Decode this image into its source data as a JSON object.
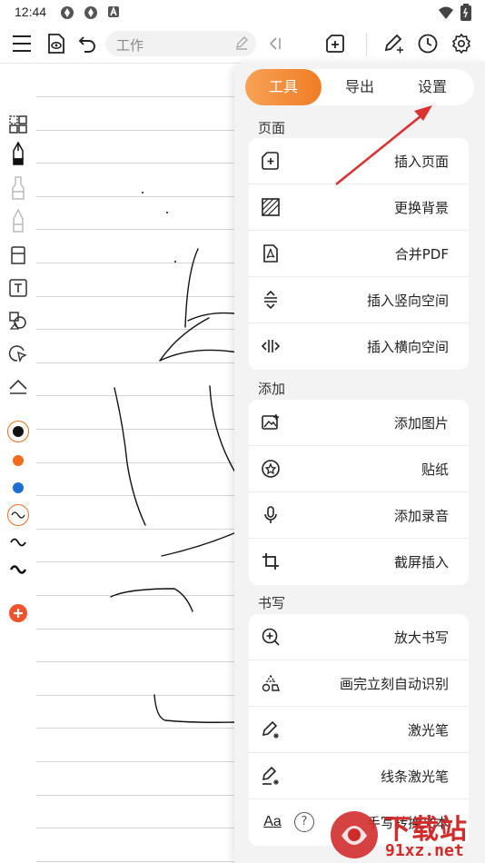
{
  "status_bar": {
    "time": "12:44"
  },
  "toolbar": {
    "title": "工作"
  },
  "panel": {
    "tabs": [
      {
        "label": "工具",
        "active": true
      },
      {
        "label": "导出",
        "active": false
      },
      {
        "label": "设置",
        "active": false
      }
    ],
    "sections": [
      {
        "title": "页面",
        "items": [
          "插入页面",
          "更换背景",
          "合并PDF",
          "插入竖向空间",
          "插入横向空间"
        ]
      },
      {
        "title": "添加",
        "items": [
          "添加图片",
          "贴纸",
          "添加录音",
          "截屏插入"
        ]
      },
      {
        "title": "书写",
        "items": [
          "放大书写",
          "画完立刻自动识别",
          "激光笔",
          "线条激光笔",
          "手写转换文本"
        ]
      }
    ],
    "help_glyph": "?",
    "font_icon_label": "Aa"
  },
  "colors": {
    "accent": "#f07c26",
    "pen_black": "#111111",
    "pen_orange": "#f26a1b",
    "pen_blue": "#1f6fd0",
    "add_button": "#f0522c",
    "annotation_arrow": "#d93232"
  },
  "watermark": {
    "text": "下载站",
    "sub": "91xz.net"
  }
}
